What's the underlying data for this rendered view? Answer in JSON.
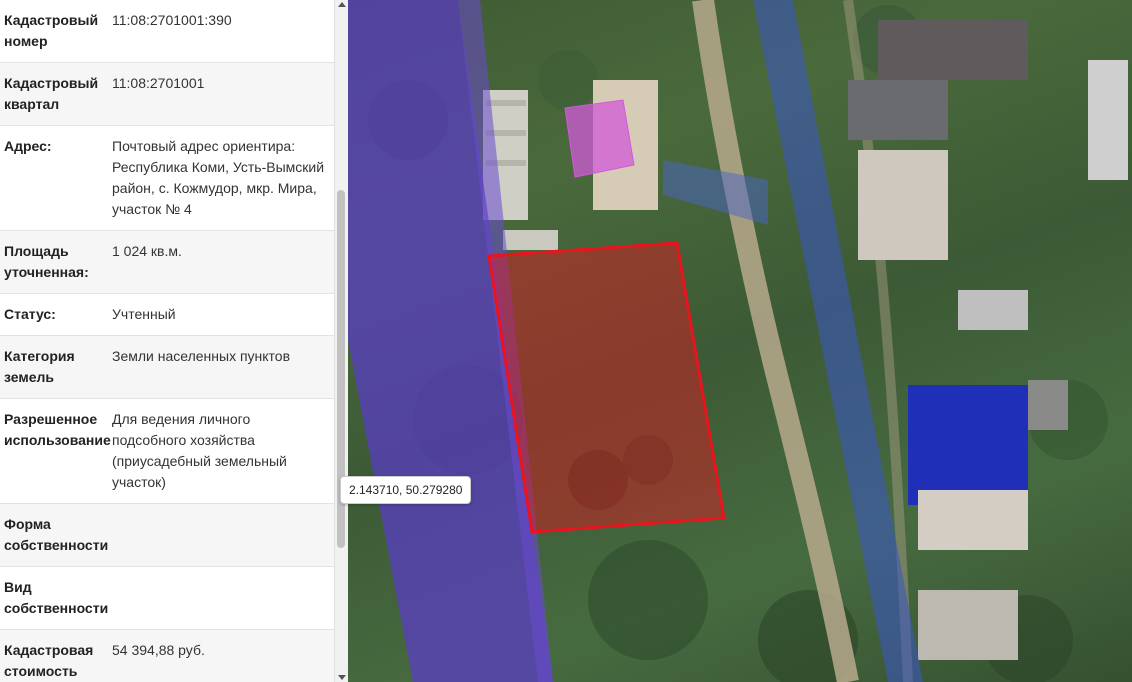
{
  "info_panel": {
    "rows": [
      {
        "label": "Кадастровый номер",
        "value": "11:08:2701001:390"
      },
      {
        "label": "Кадастровый квартал",
        "value": "11:08:2701001"
      },
      {
        "label": "Адрес:",
        "value": "Почтовый адрес ориентира: Республика Коми, Усть-Вымский район, с. Кожмудор, мкр. Мира, участок № 4"
      },
      {
        "label": "Площадь уточненная:",
        "value": "1 024 кв.м."
      },
      {
        "label": "Статус:",
        "value": "Учтенный"
      },
      {
        "label": "Категория земель",
        "value": "Земли населенных пунктов"
      },
      {
        "label": "Разрешенное использование",
        "value": "Для ведения личного подсобного хозяйства (приусадебный земельный участок)"
      },
      {
        "label": "Форма собственности",
        "value": ""
      },
      {
        "label": "Вид собственности",
        "value": ""
      },
      {
        "label": "Кадастровая стоимость",
        "value": "54 394,88 руб."
      }
    ]
  },
  "map": {
    "coordinate_tooltip": "2.143710, 50.279280",
    "selected_parcel_color": "#e8141e",
    "zone_overlay_color": "#5a3cc8",
    "neighbor_parcel_color": "#d05ad8"
  }
}
